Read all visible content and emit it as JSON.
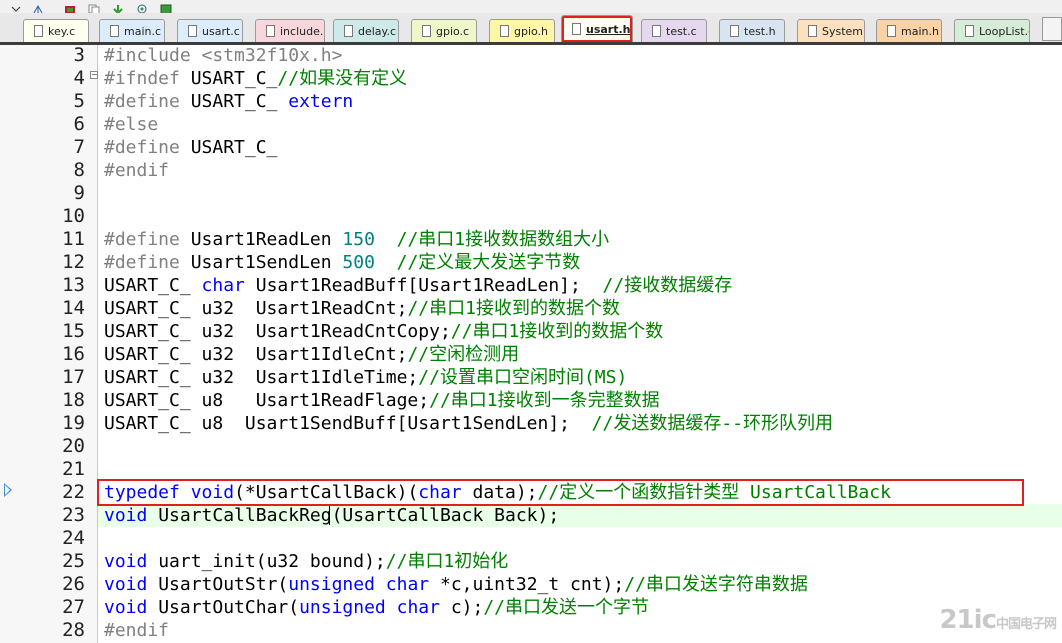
{
  "tabs": [
    {
      "label": "key.c",
      "color": "#fffff0"
    },
    {
      "label": "main.c",
      "color": "#dcecfa"
    },
    {
      "label": "usart.c",
      "color": "#dcecfa"
    },
    {
      "label": "include.h",
      "color": "#f7d7dc"
    },
    {
      "label": "delay.c",
      "color": "#cdeae8"
    },
    {
      "label": "gpio.c",
      "color": "#eef7c9"
    },
    {
      "label": "gpio.h",
      "color": "#fff7a8"
    },
    {
      "label": "usart.h",
      "color": "#fffff4",
      "active": true
    },
    {
      "label": "test.c",
      "color": "#e5d7ee"
    },
    {
      "label": "test.h",
      "color": "#d8e4f0"
    },
    {
      "label": "System.c",
      "color": "#fde0c0"
    },
    {
      "label": "main.h",
      "color": "#f9d2a6"
    },
    {
      "label": "LoopList.c",
      "color": "#d7ecd7"
    }
  ],
  "lines": [
    {
      "num": "3",
      "segs": [
        {
          "t": "#include ",
          "c": "pp"
        },
        {
          "t": "<stm32f10x.h>",
          "c": "str"
        }
      ]
    },
    {
      "num": "4",
      "segs": [
        {
          "t": "#ifndef ",
          "c": "pp"
        },
        {
          "t": "USART_C_"
        },
        {
          "t": "//如果没有定义",
          "c": "cm"
        }
      ]
    },
    {
      "num": "5",
      "segs": [
        {
          "t": "#define ",
          "c": "pp"
        },
        {
          "t": "USART_C_ "
        },
        {
          "t": "extern",
          "c": "kw"
        }
      ]
    },
    {
      "num": "6",
      "segs": [
        {
          "t": "#else",
          "c": "pp"
        }
      ]
    },
    {
      "num": "7",
      "segs": [
        {
          "t": "#define ",
          "c": "pp"
        },
        {
          "t": "USART_C_"
        }
      ]
    },
    {
      "num": "8",
      "segs": [
        {
          "t": "#endif",
          "c": "pp"
        }
      ]
    },
    {
      "num": "9",
      "segs": []
    },
    {
      "num": "10",
      "segs": []
    },
    {
      "num": "11",
      "segs": [
        {
          "t": "#define ",
          "c": "pp"
        },
        {
          "t": "Usart1ReadLen "
        },
        {
          "t": "150",
          "c": "num"
        },
        {
          "t": "  "
        },
        {
          "t": "//串口1接收数据数组大小",
          "c": "cm"
        }
      ]
    },
    {
      "num": "12",
      "segs": [
        {
          "t": "#define ",
          "c": "pp"
        },
        {
          "t": "Usart1SendLen "
        },
        {
          "t": "500",
          "c": "num"
        },
        {
          "t": "  "
        },
        {
          "t": "//定义最大发送字节数",
          "c": "cm"
        }
      ]
    },
    {
      "num": "13",
      "segs": [
        {
          "t": "USART_C_ "
        },
        {
          "t": "char",
          "c": "kw"
        },
        {
          "t": " Usart1ReadBuff[Usart1ReadLen];  "
        },
        {
          "t": "//接收数据缓存",
          "c": "cm"
        }
      ]
    },
    {
      "num": "14",
      "segs": [
        {
          "t": "USART_C_ u32  Usart1ReadCnt;"
        },
        {
          "t": "//串口1接收到的数据个数",
          "c": "cm"
        }
      ]
    },
    {
      "num": "15",
      "segs": [
        {
          "t": "USART_C_ u32  Usart1ReadCntCopy;"
        },
        {
          "t": "//串口1接收到的数据个数",
          "c": "cm"
        }
      ]
    },
    {
      "num": "16",
      "segs": [
        {
          "t": "USART_C_ u32  Usart1IdleCnt;"
        },
        {
          "t": "//空闲检测用",
          "c": "cm"
        }
      ]
    },
    {
      "num": "17",
      "segs": [
        {
          "t": "USART_C_ u32  Usart1IdleTime;"
        },
        {
          "t": "//设置串口空闲时间(MS)",
          "c": "cm"
        }
      ]
    },
    {
      "num": "18",
      "segs": [
        {
          "t": "USART_C_ u8   Usart1ReadFlage;"
        },
        {
          "t": "//串口1接收到一条完整数据",
          "c": "cm"
        }
      ]
    },
    {
      "num": "19",
      "segs": [
        {
          "t": "USART_C_ u8  Usart1SendBuff[Usart1SendLen];  "
        },
        {
          "t": "//发送数据缓存--环形队列用",
          "c": "cm"
        }
      ]
    },
    {
      "num": "20",
      "segs": []
    },
    {
      "num": "21",
      "segs": []
    },
    {
      "num": "22",
      "segs": [
        {
          "t": "typedef",
          "c": "kw"
        },
        {
          "t": " "
        },
        {
          "t": "void",
          "c": "kw"
        },
        {
          "t": "(*UsartCallBack)("
        },
        {
          "t": "char",
          "c": "kw"
        },
        {
          "t": " data);"
        },
        {
          "t": "//定义一个函数指针类型 UsartCallBack",
          "c": "cm"
        }
      ]
    },
    {
      "num": "23",
      "segs": [
        {
          "t": "void",
          "c": "kw"
        },
        {
          "t": " UsartCallBackReg(UsartCallBack Back);"
        }
      ]
    },
    {
      "num": "24",
      "segs": []
    },
    {
      "num": "25",
      "segs": [
        {
          "t": "void",
          "c": "kw"
        },
        {
          "t": " uart_init(u32 bound);"
        },
        {
          "t": "//串口1初始化",
          "c": "cm"
        }
      ]
    },
    {
      "num": "26",
      "segs": [
        {
          "t": "void",
          "c": "kw"
        },
        {
          "t": " UsartOutStr("
        },
        {
          "t": "unsigned",
          "c": "kw"
        },
        {
          "t": " "
        },
        {
          "t": "char",
          "c": "kw"
        },
        {
          "t": " *c,uint32_t cnt);"
        },
        {
          "t": "//串口发送字符串数据",
          "c": "cm"
        }
      ]
    },
    {
      "num": "27",
      "segs": [
        {
          "t": "void",
          "c": "kw"
        },
        {
          "t": " UsartOutChar("
        },
        {
          "t": "unsigned",
          "c": "kw"
        },
        {
          "t": " "
        },
        {
          "t": "char",
          "c": "kw"
        },
        {
          "t": " c);"
        },
        {
          "t": "//串口发送一个字节",
          "c": "cm"
        }
      ]
    },
    {
      "num": "28",
      "segs": [
        {
          "t": "#endif",
          "c": "pp"
        }
      ]
    }
  ],
  "watermark": {
    "main": "21ic",
    "sub": "中国电子网"
  },
  "colors": {
    "keyword": "#0000ff",
    "preprocessor": "#808080",
    "comment": "#008000",
    "number": "#008080",
    "highlight": "#e02020"
  }
}
